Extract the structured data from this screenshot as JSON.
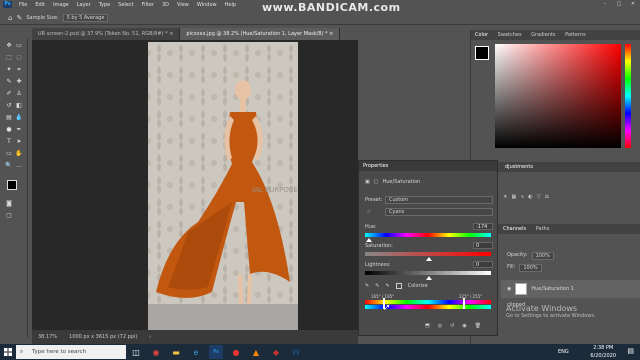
{
  "menubar": {
    "app_icon": "Ps",
    "items": [
      "File",
      "Edit",
      "Image",
      "Layer",
      "Type",
      "Select",
      "Filter",
      "3D",
      "View",
      "Window",
      "Help"
    ]
  },
  "watermark": "www.BANDICAM.com",
  "options": {
    "sample_size_label": "Sample Size:",
    "sample_size_value": "5 by 5 Average"
  },
  "doc_tabs": [
    {
      "label": "UR screen-2.psd @ 37.9% (Token No. 51, RGB/8#) *"
    },
    {
      "label": "picxxxx.jpg @ 38.2% (Hue/Saturation 1, Layer Mask/8) *"
    }
  ],
  "status": {
    "zoom": "38.17%",
    "info": "1000 px x 3615 px (72 ppi)"
  },
  "photo": {
    "overlay_text": "IAL PURPOSES"
  },
  "right_panel": {
    "tabs": [
      "Color",
      "Swatches",
      "Gradients",
      "Patterns"
    ],
    "adjustments_label": "djustments",
    "layers_tabs": [
      "Channels",
      "Paths"
    ],
    "opacity_label": "Opacity:",
    "opacity_value": "100%",
    "fill_label": "Fill:",
    "fill_value": "100%",
    "layer_name": "Hue/Saturation 1",
    "clipped_label": "clipped"
  },
  "properties": {
    "title": "Properties",
    "adjustment": "Hue/Saturation",
    "preset_label": "Preset:",
    "preset_value": "Custom",
    "channel_value": "Cyans",
    "hue_label": "Hue:",
    "hue_value": "-174",
    "saturation_label": "Saturation:",
    "saturation_value": "0",
    "lightness_label": "Lightness:",
    "lightness_value": "0",
    "colorize_label": "Colorize",
    "range_left": "165° / 195°",
    "range_right": "225° \\ 255°"
  },
  "activate": {
    "line1": "Activate Windows",
    "line2": "Go to Settings to activate Windows."
  },
  "taskbar": {
    "search_placeholder": "Type here to search",
    "time": "2:38 PM",
    "date": "6/20/2020",
    "lang": "ENG"
  }
}
